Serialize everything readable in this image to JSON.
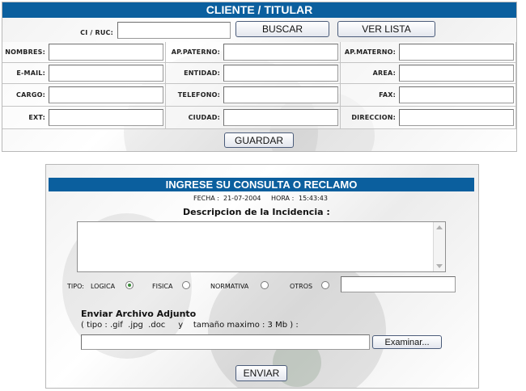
{
  "cliente": {
    "title": "CLIENTE / TITULAR",
    "ci_ruc_label": "CI / RUC:",
    "buscar_label": "BUSCAR",
    "ver_lista_label": "VER LISTA",
    "fields": {
      "nombres": "NOMBRES:",
      "ap_paterno": "AP.PATERNO:",
      "ap_materno": "AP.MATERNO:",
      "email": "E-MAIL:",
      "entidad": "ENTIDAD:",
      "area": "AREA:",
      "cargo": "CARGO:",
      "telefono": "TELEFONO:",
      "fax": "FAX:",
      "ext": "EXT:",
      "ciudad": "CIUDAD:",
      "direccion": "DIRECCION:"
    },
    "guardar_label": "GUARDAR"
  },
  "consulta": {
    "title": "INGRESE SU CONSULTA O RECLAMO",
    "fecha_label": "FECHA :",
    "fecha_value": "21-07-2004",
    "hora_label": "HORA :",
    "hora_value": "15:43:43",
    "descripcion_label": "Descripcion de la Incidencia :",
    "tipo_label": "TIPO:",
    "tipos": [
      "LOGICA",
      "FISICA",
      "NORMATIVA",
      "OTROS"
    ],
    "tipo_selected": "LOGICA",
    "adjunto_title": "Enviar Archivo Adjunto",
    "adjunto_hint": "( tipo : .gif  .jpg  .doc     y    tamaño maximo : 3 Mb ) :",
    "examinar_label": "Examinar...",
    "enviar_label": "ENVIAR"
  },
  "colors": {
    "header_bar": "#0b5f9e",
    "radio_selected": "#3a8a3a"
  }
}
